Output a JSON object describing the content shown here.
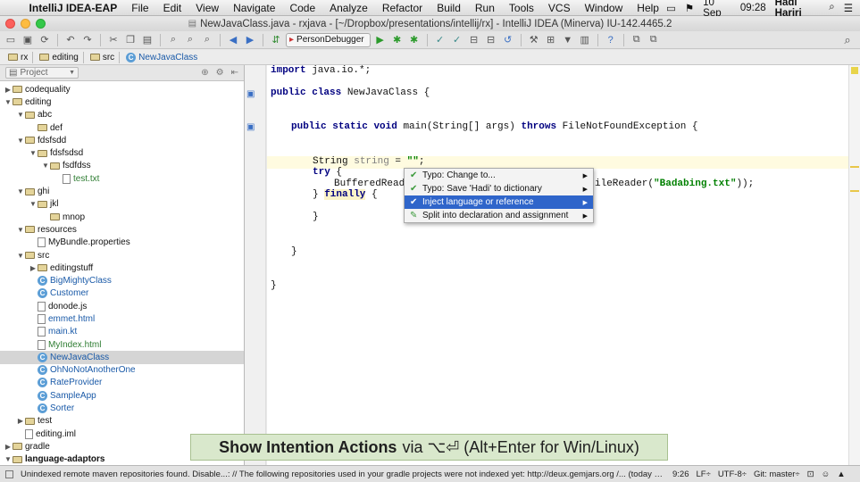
{
  "menubar": {
    "app": "IntelliJ IDEA-EAP",
    "items": [
      "File",
      "Edit",
      "View",
      "Navigate",
      "Code",
      "Analyze",
      "Refactor",
      "Build",
      "Run",
      "Tools",
      "VCS",
      "Window",
      "Help"
    ],
    "date": "10 Sep",
    "time": "09:28",
    "user": "Hadi Hariri"
  },
  "window": {
    "title": "NewJavaClass.java - rxjava - [~/Dropbox/presentations/intellij/rx] - IntelliJ IDEA (Minerva) IU-142.4465.2"
  },
  "toolbar": {
    "run_config": "PersonDebugger"
  },
  "breadcrumbs": [
    "rx",
    "editing",
    "src",
    "NewJavaClass"
  ],
  "project_panel": {
    "title": "Project",
    "tree": [
      {
        "label": "codequality",
        "type": "folder",
        "depth": 0,
        "expanded": false
      },
      {
        "label": "editing",
        "type": "folder",
        "depth": 0,
        "expanded": true
      },
      {
        "label": "abc",
        "type": "folder",
        "depth": 1,
        "expanded": true
      },
      {
        "label": "def",
        "type": "folder",
        "depth": 2,
        "expanded": null
      },
      {
        "label": "fdsfsdd",
        "type": "folder",
        "depth": 1,
        "expanded": true
      },
      {
        "label": "fdsfsdsd",
        "type": "folder",
        "depth": 2,
        "expanded": true
      },
      {
        "label": "fsdfdss",
        "type": "folder",
        "depth": 3,
        "expanded": true
      },
      {
        "label": "test.txt",
        "type": "file",
        "depth": 4,
        "expanded": null
      },
      {
        "label": "ghi",
        "type": "folder",
        "depth": 1,
        "expanded": true
      },
      {
        "label": "jkl",
        "type": "folder",
        "depth": 2,
        "expanded": true
      },
      {
        "label": "mnop",
        "type": "folder",
        "depth": 3,
        "expanded": null
      },
      {
        "label": "resources",
        "type": "folder",
        "depth": 1,
        "expanded": true
      },
      {
        "label": "MyBundle.properties",
        "type": "file",
        "depth": 2,
        "expanded": null
      },
      {
        "label": "src",
        "type": "folder",
        "depth": 1,
        "expanded": true
      },
      {
        "label": "editingstuff",
        "type": "folder",
        "depth": 2,
        "expanded": false
      },
      {
        "label": "BigMightyClass",
        "type": "class",
        "depth": 2,
        "expanded": null
      },
      {
        "label": "Customer",
        "type": "class",
        "depth": 2,
        "expanded": null
      },
      {
        "label": "donode.js",
        "type": "file",
        "depth": 2,
        "expanded": null
      },
      {
        "label": "emmet.html",
        "type": "file",
        "depth": 2,
        "expanded": null
      },
      {
        "label": "main.kt",
        "type": "file",
        "depth": 2,
        "expanded": null
      },
      {
        "label": "MyIndex.html",
        "type": "file",
        "depth": 2,
        "expanded": null
      },
      {
        "label": "NewJavaClass",
        "type": "class",
        "depth": 2,
        "expanded": null,
        "selected": true
      },
      {
        "label": "OhNoNotAnotherOne",
        "type": "class",
        "depth": 2,
        "expanded": null
      },
      {
        "label": "RateProvider",
        "type": "class",
        "depth": 2,
        "expanded": null
      },
      {
        "label": "SampleApp",
        "type": "class",
        "depth": 2,
        "expanded": null
      },
      {
        "label": "Sorter",
        "type": "class",
        "depth": 2,
        "expanded": null
      },
      {
        "label": "test",
        "type": "folder",
        "depth": 1,
        "expanded": false
      },
      {
        "label": "editing.iml",
        "type": "file",
        "depth": 1,
        "expanded": null
      },
      {
        "label": "gradle",
        "type": "folder",
        "depth": 0,
        "expanded": false
      },
      {
        "label": "language-adaptors",
        "type": "folder",
        "depth": 0,
        "expanded": true
      }
    ]
  },
  "editor": {
    "line1_kw": "import",
    "line1_rest": " java.io.*;",
    "line2_kw1": "public",
    "line2_kw2": "class",
    "line2_rest": " NewJavaClass {",
    "line3_kw1": "public",
    "line3_kw2": "static",
    "line3_kw3": "void",
    "line3_mid": " main(String[] args) ",
    "line3_kw4": "throws",
    "line3_rest": " FileNotFoundException {",
    "line4_type": "String ",
    "line4_var": "string",
    "line4_eq": " = ",
    "line4_str": "\"\"",
    "line4_end": ";",
    "line5_kw": "try",
    "line5_rest": " {",
    "line6_a": "BufferedReade",
    "line6_b": "ileReader(",
    "line6_str": "\"Badabing.txt\"",
    "line6_c": "));",
    "line7_a": "} ",
    "line7_kw": "finally",
    "line7_b": " {",
    "line8": "}",
    "line9": "}",
    "line10": "}"
  },
  "intention_popup": {
    "items": [
      {
        "label": "Typo: Change to...",
        "icon": "typo-icon",
        "selected": false
      },
      {
        "label": "Typo: Save 'Hadi' to dictionary",
        "icon": "typo-icon",
        "selected": false
      },
      {
        "label": "Inject language or reference",
        "icon": "check-icon",
        "selected": true
      },
      {
        "label": "Split into declaration and assignment",
        "icon": "pencil-icon",
        "selected": false
      }
    ]
  },
  "hint": {
    "bold": "Show Intention Actions",
    "rest": "via ⌥⏎ (Alt+Enter for Win/Linux)"
  },
  "statusbar": {
    "message": "Unindexed remote maven repositories found. Disable...: // The following repositories used in your gradle projects were not indexed yet: http://deux.gemjars.org /... (today 06:09)",
    "position": "9:26",
    "line_sep": "LF÷",
    "encoding": "UTF-8÷",
    "git": "Git: master÷"
  },
  "colors": {
    "selection": "#2f65ca",
    "keyword": "#000080",
    "string": "#008000",
    "hint_bg": "#d9e8cc"
  }
}
